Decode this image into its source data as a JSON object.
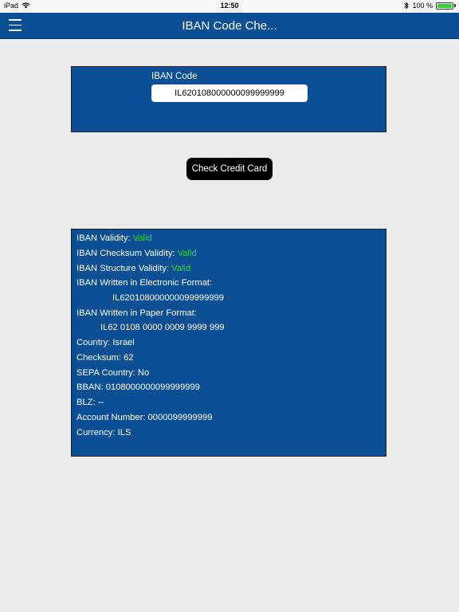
{
  "status_bar": {
    "device": "iPad",
    "time": "12:50",
    "battery_text": "100 %",
    "battery_level": 1.0
  },
  "nav": {
    "title": "IBAN Code Che..."
  },
  "input": {
    "label": "IBAN Code",
    "value": "IL620108000000099999999"
  },
  "check_button": {
    "label": "Check Credit Card"
  },
  "results": {
    "validity_label": "IBAN Validity:",
    "validity_value": "Valid",
    "checksum_validity_label": "IBAN Checksum Validity:",
    "checksum_validity_value": "Valid",
    "structure_validity_label": "IBAN Structure Validity:",
    "structure_validity_value": "Valid",
    "electronic_label": "IBAN Written in Electronic Format:",
    "electronic_value": "IL620108000000099999999",
    "paper_label": "IBAN Written in Paper Format:",
    "paper_value": "IL62 0108 0000 0009 9999 999",
    "country_label": "Country:",
    "country_value": "Israel",
    "checksum_label": "Checksum:",
    "checksum_value": "62",
    "sepa_label": "SEPA Country:",
    "sepa_value": "No",
    "bban_label": "BBAN:",
    "bban_value": "0108000000099999999",
    "blz_label": "BLZ:",
    "blz_value": "--",
    "account_label": "Account Number:",
    "account_value": "0000099999999",
    "currency_label": "Currency:",
    "currency_value": "ILS"
  },
  "colors": {
    "nav_blue": "#0a4e94",
    "valid_green": "#22dd22",
    "background": "#ebebeb"
  }
}
